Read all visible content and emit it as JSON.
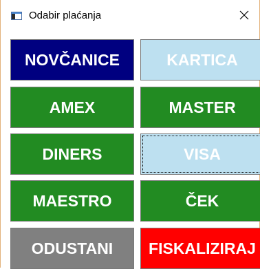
{
  "window": {
    "title": "Odabir plaćanja",
    "app_icon": "window-app-icon",
    "close_icon": "close-icon"
  },
  "payment_buttons": [
    {
      "label": "NOVČANICE",
      "color": "#000080"
    },
    {
      "label": "KARTICA",
      "color": "#bde0f0"
    },
    {
      "label": "AMEX",
      "color": "#228b22"
    },
    {
      "label": "MASTER",
      "color": "#228b22"
    },
    {
      "label": "DINERS",
      "color": "#228b22"
    },
    {
      "label": "VISA",
      "color": "#bde0f0"
    },
    {
      "label": "MAESTRO",
      "color": "#228b22"
    },
    {
      "label": "ČEK",
      "color": "#228b22"
    },
    {
      "label": "ODUSTANI",
      "color": "#808080"
    },
    {
      "label": "FISKALIZIRAJ",
      "color": "#ff0000"
    }
  ]
}
